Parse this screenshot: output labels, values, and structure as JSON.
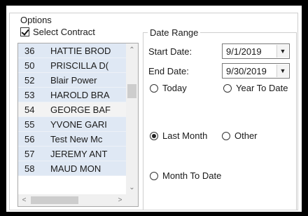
{
  "options": {
    "group_title": "Options",
    "select_contract_label": "Select Contract",
    "select_contract_checked": true
  },
  "contracts": {
    "rows": [
      {
        "id": "36",
        "name": "HATTIE BROD"
      },
      {
        "id": "50",
        "name": "PRISCILLA D("
      },
      {
        "id": "52",
        "name": "Blair Power"
      },
      {
        "id": "53",
        "name": "HAROLD BRA"
      },
      {
        "id": "54",
        "name": "GEORGE BAF"
      },
      {
        "id": "55",
        "name": "YVONE GARI"
      },
      {
        "id": "56",
        "name": "Test New Mc"
      },
      {
        "id": "57",
        "name": "JEREMY ANT"
      },
      {
        "id": "58",
        "name": "MAUD MON"
      }
    ],
    "selected_id": "54",
    "scroll_up_icon": "chevron-up-icon",
    "scroll_down_icon": "chevron-down-icon",
    "scroll_left_icon": "chevron-left-icon",
    "scroll_right_icon": "chevron-right-icon"
  },
  "date_range": {
    "title": "Date Range",
    "start_label": "Start Date:",
    "start_value": "9/1/2019",
    "end_label": "End Date:",
    "end_value": "9/30/2019",
    "radios": {
      "today": "Today",
      "year_to_date": "Year To Date",
      "last_month": "Last Month",
      "other": "Other",
      "month_to_date": "Month To Date"
    },
    "selected_radio": "last_month"
  }
}
